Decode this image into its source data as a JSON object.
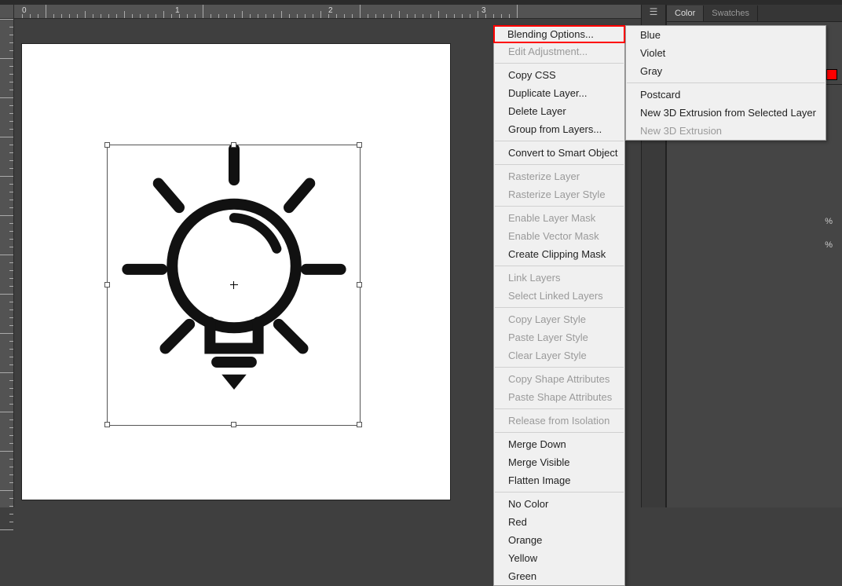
{
  "ruler": {
    "labels": [
      "0",
      "1",
      "2",
      "3"
    ]
  },
  "panels": {
    "tabs": [
      "Color",
      "Swatches"
    ],
    "active_tab": 0
  },
  "contextMenu": {
    "groups": [
      [
        {
          "label": "Blending Options...",
          "highlighted": true
        },
        {
          "label": "Edit Adjustment...",
          "disabled": true
        }
      ],
      [
        {
          "label": "Copy CSS"
        },
        {
          "label": "Duplicate Layer..."
        },
        {
          "label": "Delete Layer"
        },
        {
          "label": "Group from Layers..."
        }
      ],
      [
        {
          "label": "Convert to Smart Object"
        }
      ],
      [
        {
          "label": "Rasterize Layer",
          "disabled": true
        },
        {
          "label": "Rasterize Layer Style",
          "disabled": true
        }
      ],
      [
        {
          "label": "Enable Layer Mask",
          "disabled": true
        },
        {
          "label": "Enable Vector Mask",
          "disabled": true
        },
        {
          "label": "Create Clipping Mask"
        }
      ],
      [
        {
          "label": "Link Layers",
          "disabled": true
        },
        {
          "label": "Select Linked Layers",
          "disabled": true
        }
      ],
      [
        {
          "label": "Copy Layer Style",
          "disabled": true
        },
        {
          "label": "Paste Layer Style",
          "disabled": true
        },
        {
          "label": "Clear Layer Style",
          "disabled": true
        }
      ],
      [
        {
          "label": "Copy Shape Attributes",
          "disabled": true
        },
        {
          "label": "Paste Shape Attributes",
          "disabled": true
        }
      ],
      [
        {
          "label": "Release from Isolation",
          "disabled": true
        }
      ],
      [
        {
          "label": "Merge Down"
        },
        {
          "label": "Merge Visible"
        },
        {
          "label": "Flatten Image"
        }
      ],
      [
        {
          "label": "No Color"
        },
        {
          "label": "Red"
        },
        {
          "label": "Orange"
        },
        {
          "label": "Yellow"
        },
        {
          "label": "Green"
        }
      ]
    ]
  },
  "subMenu": {
    "groups": [
      [
        {
          "label": "Blue"
        },
        {
          "label": "Violet"
        },
        {
          "label": "Gray"
        }
      ],
      [
        {
          "label": "Postcard"
        },
        {
          "label": "New 3D Extrusion from Selected Layer"
        },
        {
          "label": "New 3D Extrusion",
          "disabled": true
        }
      ]
    ]
  },
  "pct": "%"
}
